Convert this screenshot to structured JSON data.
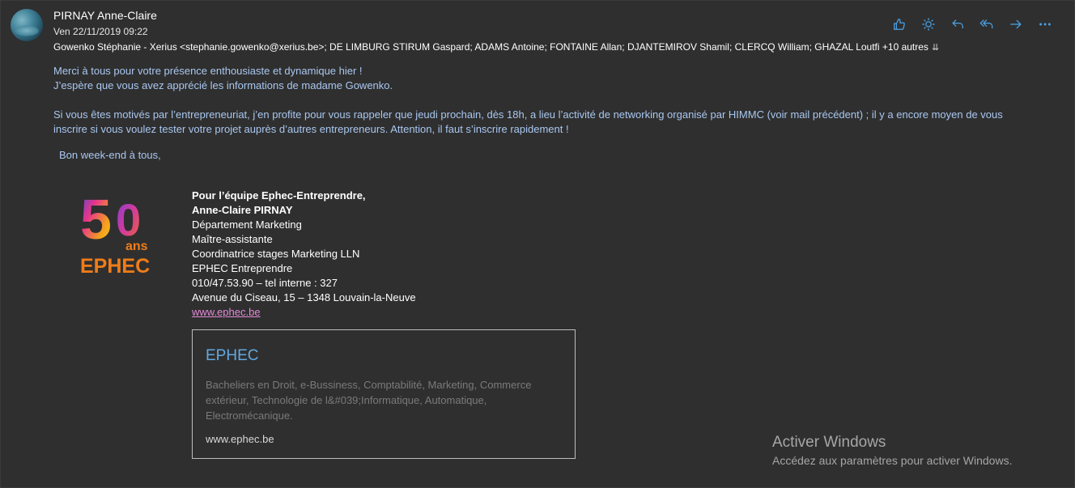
{
  "header": {
    "sender": "PIRNAY Anne-Claire",
    "date": "Ven 22/11/2019 09:22",
    "recipients": "Gowenko Stéphanie - Xerius <stephanie.gowenko@xerius.be>; DE LIMBURG STIRUM Gaspard; ADAMS Antoine; FONTAINE Allan; DJANTEMIROV Shamil; CLERCQ William; GHAZAL Loutfi +10 autres",
    "more_icon": "double-chevron-down-icon"
  },
  "actions": [
    {
      "name": "like-button",
      "icon": "thumbs-up-icon"
    },
    {
      "name": "sun-button",
      "icon": "sun-icon"
    },
    {
      "name": "reply-button",
      "icon": "reply-icon"
    },
    {
      "name": "reply-all-button",
      "icon": "reply-all-icon"
    },
    {
      "name": "forward-button",
      "icon": "forward-arrow-icon"
    },
    {
      "name": "more-button",
      "icon": "ellipsis-icon"
    }
  ],
  "body": {
    "line1": "Merci à tous pour votre présence enthousiaste et dynamique hier !",
    "line2": "J’espère que vous avez apprécié les informations de madame Gowenko.",
    "line3": "Si vous êtes motivés par l’entrepreneuriat, j’en profite pour vous rappeler que jeudi prochain, dès 18h, a lieu l’activité de networking organisé par HIMMC (voir mail précédent) ; il y a encore moyen de vous",
    "line4": "inscrire si vous voulez tester votre projet auprès d’autres entrepreneurs. Attention, il faut s’inscrire rapidement !",
    "greeting": "Bon week-end à tous,"
  },
  "logo": {
    "number": "50",
    "ans": "ans",
    "brand": "EPHEC"
  },
  "signature": {
    "team": "Pour l’équipe Ephec-Entreprendre,",
    "name": "Anne-Claire PIRNAY",
    "dept": "Département Marketing",
    "role": "Maître-assistante",
    "coord": "Coordinatrice stages Marketing LLN",
    "org": "EPHEC Entreprendre",
    "phone": "010/47.53.90 – tel interne : 327",
    "address": "Avenue du Ciseau, 15 – 1348 Louvain-la-Neuve",
    "website": "www.ephec.be"
  },
  "link_card": {
    "title": "EPHEC",
    "description": "Bacheliers en Droit, e-Bussiness, Comptabilité, Marketing, Commerce extérieur, Technologie de l&#039;Informatique, Automatique, Electromécanique.",
    "url": "www.ephec.be"
  },
  "watermark": {
    "title": "Activer Windows",
    "subtitle": "Accédez aux paramètres pour activer Windows."
  },
  "colors": {
    "background": "#2f2f2f",
    "body_text": "#a9c7f0",
    "accent": "#4aa3e8",
    "link": "#e38bd8",
    "card_title": "#62a9e0"
  }
}
